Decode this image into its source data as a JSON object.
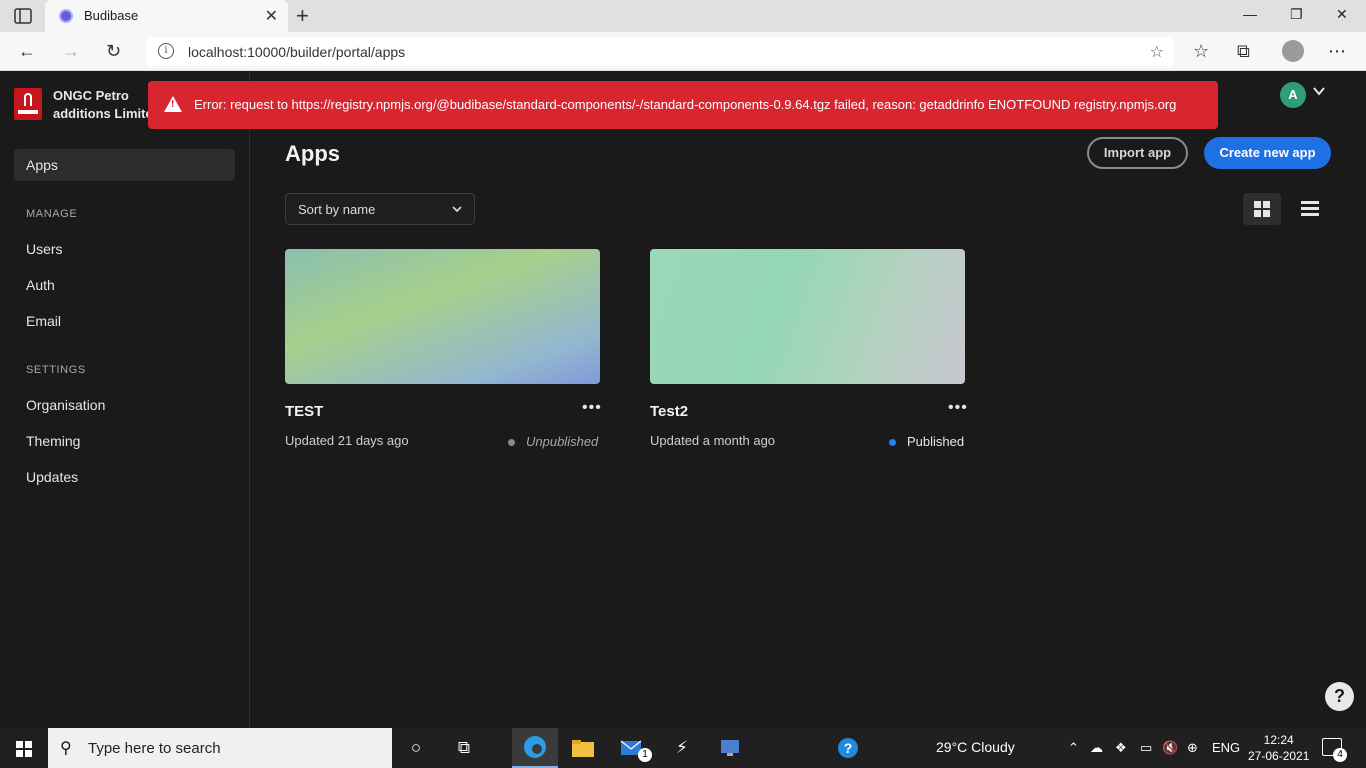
{
  "browser": {
    "tab_title": "Budibase",
    "url": "localhost:10000/builder/portal/apps",
    "new_tab_symbol": "+",
    "close_symbol": "✕"
  },
  "sidebar": {
    "org_name": "ONGC Petro additions Limited",
    "items": [
      {
        "label": "Apps",
        "active": true
      },
      {
        "label": "Users"
      },
      {
        "label": "Auth"
      },
      {
        "label": "Email"
      },
      {
        "label": "Organisation"
      },
      {
        "label": "Theming"
      },
      {
        "label": "Updates"
      }
    ],
    "sections": {
      "manage": "MANAGE",
      "settings": "SETTINGS"
    }
  },
  "error_banner": {
    "message": "Error: request to https://registry.npmjs.org/@budibase/standard-components/-/standard-components-0.9.64.tgz failed, reason: getaddrinfo ENOTFOUND registry.npmjs.org",
    "color": "#d7262f"
  },
  "user": {
    "initial": "A"
  },
  "main": {
    "title": "Apps",
    "import_label": "Import app",
    "create_label": "Create new app",
    "sort_value": "Sort by name"
  },
  "apps": [
    {
      "name": "TEST",
      "updated": "Updated 21 days ago",
      "status": "Unpublished",
      "status_color": "#8a8a8a"
    },
    {
      "name": "Test2",
      "updated": "Updated a month ago",
      "status": "Published",
      "status_color": "#2680eb"
    }
  ],
  "taskbar": {
    "search_placeholder": "Type here to search",
    "weather": "29°C  Cloudy",
    "language": "ENG",
    "time": "12:24",
    "date": "27-06-2021",
    "notification_count": "4",
    "mail_badge": "1"
  },
  "colors": {
    "accent": "#1f6fe5",
    "background": "#1a1a1a"
  }
}
